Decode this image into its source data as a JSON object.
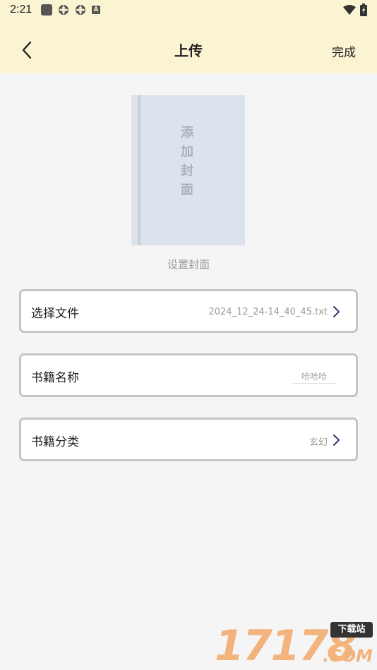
{
  "status": {
    "time": "2:21",
    "icons": [
      "square-icon",
      "gear-icon",
      "gear-icon",
      "a-icon",
      "wifi-icon",
      "battery-icon"
    ]
  },
  "nav": {
    "title": "上传",
    "done_label": "完成"
  },
  "cover": {
    "placeholder_text": "添加封面",
    "label": "设置封面"
  },
  "rows": {
    "file": {
      "label": "选择文件",
      "value": "2024_12_24-14_40_45.txt"
    },
    "name": {
      "label": "书籍名称",
      "placeholder": "哈哈哈"
    },
    "category": {
      "label": "书籍分类",
      "value": "玄幻"
    }
  },
  "watermark": {
    "number": "17178",
    "badge": "下载站",
    "domain": ".COM"
  },
  "colors": {
    "header_bg": "#faf4d2",
    "page_bg": "#f5f5f5",
    "cover_bg": "#dde3ec",
    "chevron": "#2c3a6b"
  }
}
